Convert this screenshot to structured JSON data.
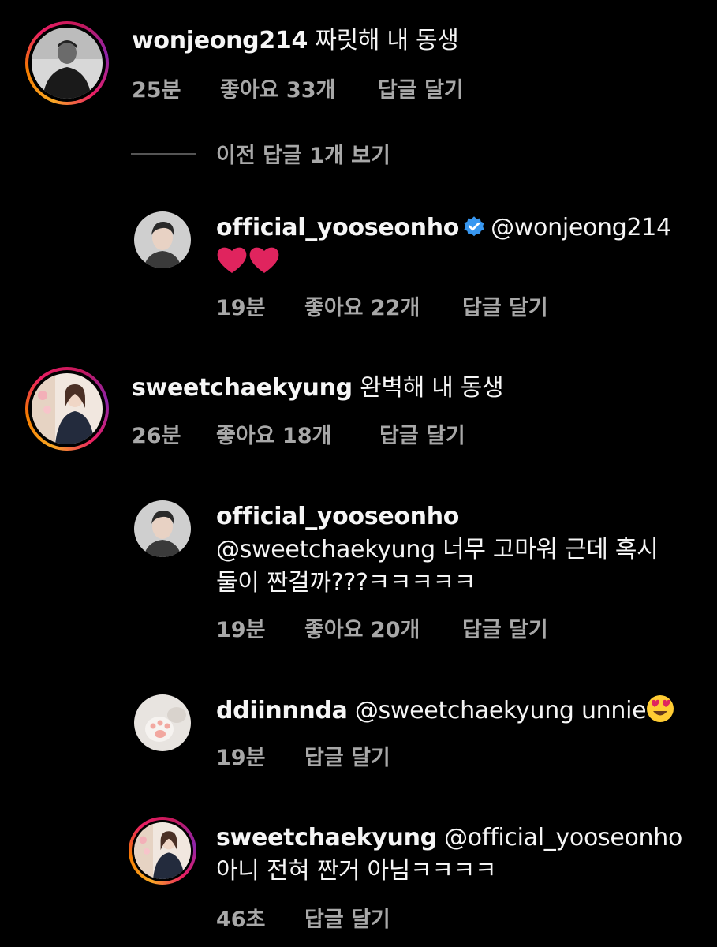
{
  "comments": [
    {
      "username": "wonjeong214",
      "text": "짜릿해 내 동생",
      "time": "25분",
      "likes": "좋아요 33개",
      "reply": "답글 달기"
    },
    {
      "username": "sweetchaekyung",
      "text": "완벽해 내 동생",
      "time": "26분",
      "likes": "좋아요 18개",
      "reply": "답글 달기"
    }
  ],
  "view_replies": "이전 답글 1개 보기",
  "replies": [
    {
      "username": "official_yooseonho",
      "verified": true,
      "mention": "@wonjeong214",
      "text": "",
      "emoji": "❤❤",
      "time": "19분",
      "likes": "좋아요 22개",
      "reply": "답글 달기"
    },
    {
      "username": "official_yooseonho",
      "mention": "@sweetchaekyung",
      "text_line1": "너무 고마워 근데 혹시",
      "text_line2": "둘이 짠걸까???ㅋㅋㅋㅋㅋ",
      "time": "19분",
      "likes": "좋아요 20개",
      "reply": "답글 달기"
    },
    {
      "username": "ddiinnnda",
      "mention": "@sweetchaekyung",
      "text": "unnie",
      "emoji": "heart-eyes",
      "time": "19분",
      "reply": "답글 달기"
    },
    {
      "username": "sweetchaekyung",
      "mention": "@official_yooseonho",
      "text_line2": "아니 전혀 짠거 아님ㅋㅋㅋㅋ",
      "time": "46초",
      "reply": "답글 달기"
    }
  ],
  "colors": {
    "background": "#000000",
    "text": "#f5f5f5",
    "meta": "#a8a8a8",
    "verified": "#3897f0",
    "heart": "#e0245e"
  }
}
